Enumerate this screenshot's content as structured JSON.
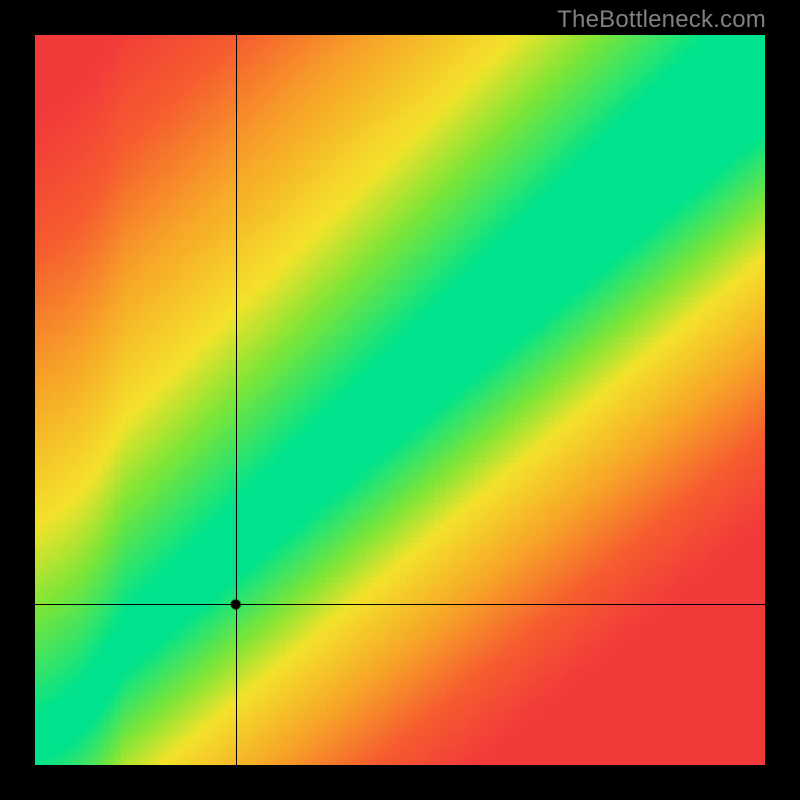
{
  "watermark": "TheBottleneck.com",
  "crosshair": {
    "x_frac": 0.275,
    "y_frac": 0.78
  },
  "marker": {
    "x_frac": 0.275,
    "y_frac": 0.78,
    "radius": 5
  },
  "chart_data": {
    "type": "heatmap",
    "title": "",
    "subtitle": "",
    "xlabel": "",
    "ylabel": "",
    "xlim": [
      0,
      1
    ],
    "ylim": [
      0,
      1
    ],
    "axis_orientation": "y increases upward",
    "description": "Bottleneck heatmap. A diagonal green band (optimal) runs from the lower-left corner to the upper-right corner with a slope slightly below 1 and a slight S-curve near the origin. The band is flanked by a yellow halo that fades through orange to red as distance from the diagonal increases. A single crosshair marks a point at roughly (0.275, 0.22) in xy (bottom-origin) space, i.e. just inside the green band near the lower-left.",
    "band": {
      "center_line_description": "y ≈ x * 0.9 with a mild ease-in near 0 and ease-out near 1",
      "half_width_frac": 0.055,
      "colors": {
        "optimal": "#00E38C",
        "near": "#F4E22A",
        "mid": "#F7A528",
        "far": "#F23A3A"
      }
    },
    "marker_point": {
      "x": 0.275,
      "y": 0.22
    },
    "legend": null,
    "grid": false
  }
}
